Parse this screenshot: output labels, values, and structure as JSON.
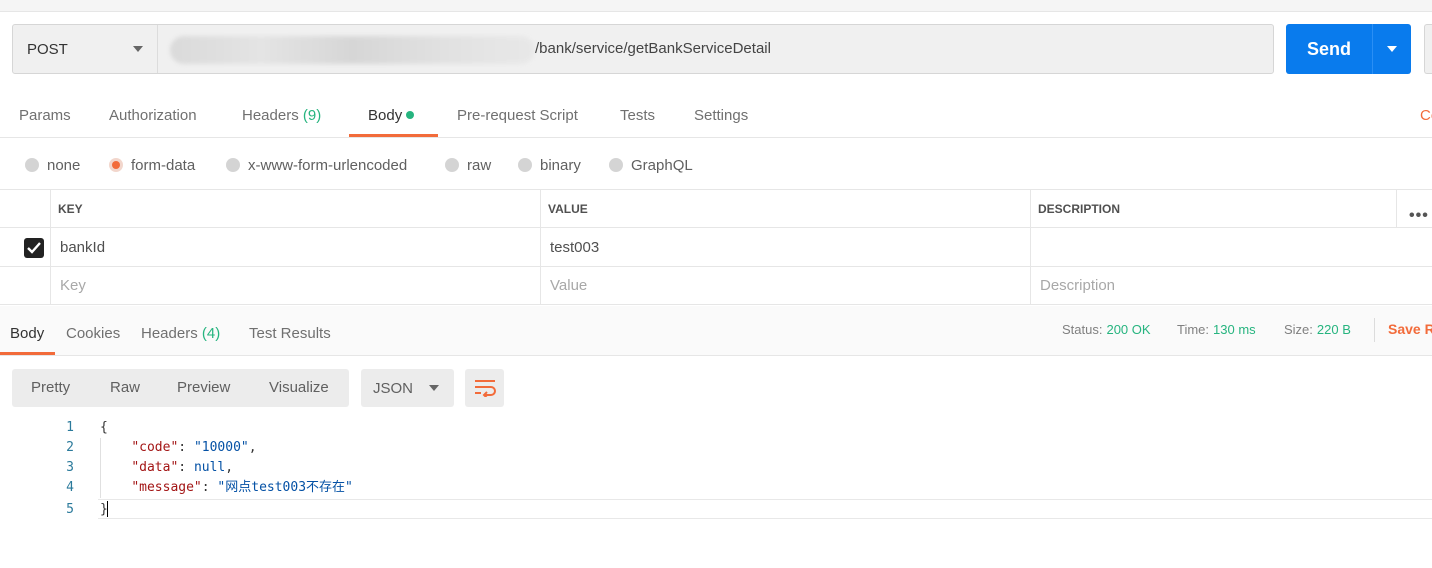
{
  "request": {
    "method": "POST",
    "url_path": "/bank/service/getBankServiceDetail",
    "send_label": "Send"
  },
  "request_tabs": {
    "params": "Params",
    "authorization": "Authorization",
    "headers": "Headers",
    "headers_count": "(9)",
    "body": "Body",
    "pre_request": "Pre-request Script",
    "tests": "Tests",
    "settings": "Settings",
    "cookies_stub": "Co"
  },
  "body_types": {
    "none": "none",
    "form_data": "form-data",
    "urlencoded": "x-www-form-urlencoded",
    "raw": "raw",
    "binary": "binary",
    "graphql": "GraphQL",
    "selected": "form-data"
  },
  "params_table": {
    "headers": {
      "key": "KEY",
      "value": "VALUE",
      "description": "DESCRIPTION"
    },
    "rows": [
      {
        "key": "bankId",
        "value": "test003",
        "description": "",
        "checked": true
      }
    ],
    "placeholders": {
      "key": "Key",
      "value": "Value",
      "description": "Description"
    }
  },
  "response_tabs": {
    "body": "Body",
    "cookies": "Cookies",
    "headers": "Headers",
    "headers_count": "(4)",
    "test_results": "Test Results"
  },
  "response_meta": {
    "status_label": "Status:",
    "status_value": "200 OK",
    "time_label": "Time:",
    "time_value": "130 ms",
    "size_label": "Size:",
    "size_value": "220 B",
    "save_response": "Save R"
  },
  "view_modes": {
    "pretty": "Pretty",
    "raw": "Raw",
    "preview": "Preview",
    "visualize": "Visualize",
    "format": "JSON"
  },
  "response_body": {
    "line_numbers": [
      "1",
      "2",
      "3",
      "4",
      "5"
    ],
    "open_brace": "{",
    "close_brace": "}",
    "fields": [
      {
        "key": "\"code\"",
        "value": "\"10000\"",
        "trail": ","
      },
      {
        "key": "\"data\"",
        "value": "null",
        "trail": ","
      },
      {
        "key": "\"message\"",
        "value": "\"网点test003不存在\"",
        "trail": ""
      }
    ]
  },
  "colors": {
    "send_blue": "#097bed",
    "accent_orange": "#f26b3a",
    "success_green": "#26b47f"
  }
}
